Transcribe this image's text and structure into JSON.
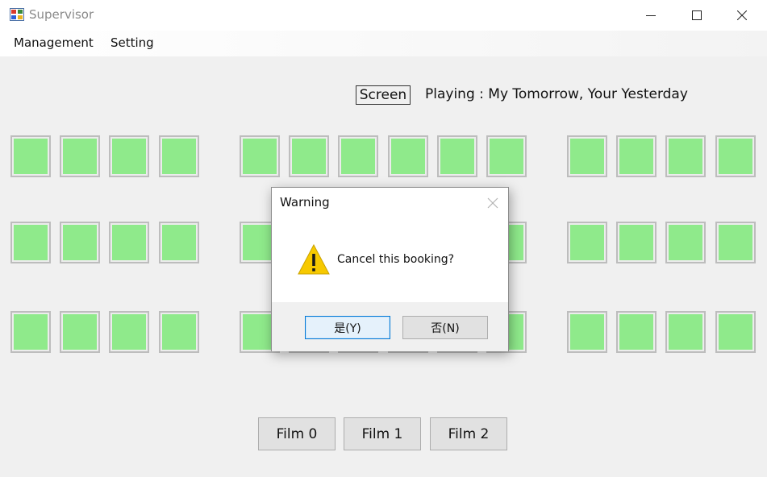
{
  "window": {
    "title": "Supervisor",
    "icon": "app-window-icon",
    "controls": [
      "minimize-icon",
      "maximize-icon",
      "close-icon"
    ]
  },
  "menu": {
    "items": [
      {
        "label": "Management"
      },
      {
        "label": "Setting"
      }
    ]
  },
  "screen": {
    "label": "Screen",
    "playing_text": "Playing : My Tomorrow, Your Yesterday"
  },
  "seats": {
    "rows": 3,
    "blocks": [
      4,
      6,
      4
    ],
    "color": "#8fea8b",
    "state": "available"
  },
  "films": [
    {
      "label": "Film 0"
    },
    {
      "label": "Film 1"
    },
    {
      "label": "Film 2"
    }
  ],
  "dialog": {
    "title": "Warning",
    "message": "Cancel this booking?",
    "icon": "warning-icon",
    "yes_label": "是(Y)",
    "no_label": "否(N)"
  },
  "colors": {
    "accent": "#0078d7",
    "seat_fill": "#8fea8b",
    "warning": "#f7c900"
  }
}
